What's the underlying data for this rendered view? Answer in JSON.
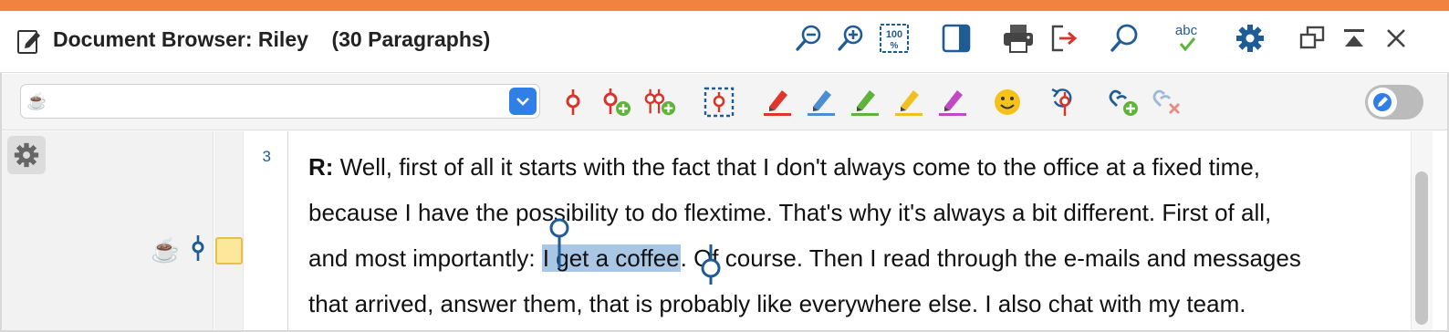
{
  "window": {
    "title": "Document Browser: Riley",
    "paragraph_count": "(30 Paragraphs)",
    "accent_color": "#f2833e",
    "title_icons": [
      "zoom-out-icon",
      "zoom-in-icon",
      "zoom-100-icon",
      "sidebar-toggle-icon",
      "print-icon",
      "export-icon",
      "search-icon",
      "spellcheck-icon",
      "settings-icon",
      "undock-icon",
      "collapse-icon",
      "close-icon"
    ]
  },
  "toolbar": {
    "code_selector": {
      "value": "☕"
    },
    "tools": [
      "code-icon",
      "code-new-icon",
      "code-multiple-new-icon",
      "code-selection-icon",
      "highlight-red-icon",
      "highlight-blue-icon",
      "highlight-green-icon",
      "highlight-yellow-icon",
      "highlight-magenta-icon",
      "emoji-icon",
      "undo-code-icon",
      "link-add-icon",
      "link-remove-icon"
    ],
    "highlight_colors": [
      "#e0352b",
      "#4a8fd4",
      "#5fb23a",
      "#f0c020",
      "#c14ac4"
    ],
    "edit_mode": false
  },
  "content": {
    "paragraph_number": "3",
    "speaker": "R:",
    "lines": {
      "l1": "Well, first of all it starts with the fact that I don't always come to the office at a fixed time,",
      "l2": "because I have the possibility to do flextime. That's why it's always a bit different. First of all,",
      "l3_before": "and most importantly: ",
      "l3_coded": "I get a coffee",
      "l3_after": ". Of course. Then I read through the e-mails and messages",
      "l4": "that arrived, answer them, that is probably like everywhere else. I also chat with my team."
    },
    "coded_segment_color": "#a9c6e5",
    "gutter_marks": {
      "code_emoji": "☕"
    }
  }
}
